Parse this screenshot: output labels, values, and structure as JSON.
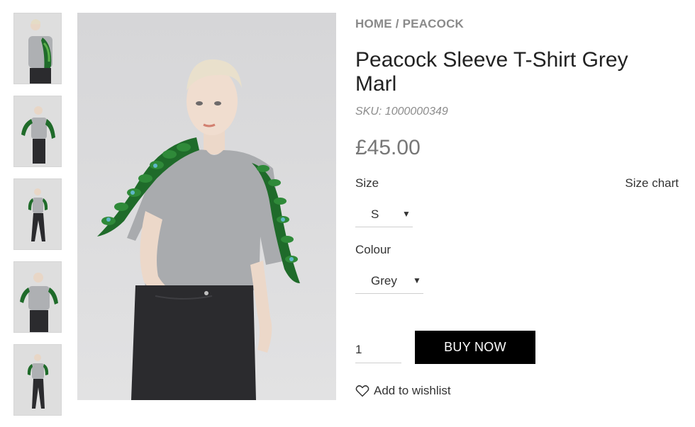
{
  "breadcrumb": {
    "home": "HOME",
    "separator": "/",
    "current": "PEACOCK"
  },
  "product": {
    "title": "Peacock Sleeve T-Shirt Grey Marl",
    "sku": "SKU: 1000000349",
    "price": "£45.00"
  },
  "options": {
    "size_label": "Size",
    "size_chart_link": "Size chart",
    "size_value": "S",
    "colour_label": "Colour",
    "colour_value": "Grey",
    "caret_glyph": "▼"
  },
  "purchase": {
    "quantity": "1",
    "buy_label": "BUY NOW",
    "wishlist_label": "Add to wishlist"
  },
  "gallery": {
    "thumbnail_count": 5,
    "icons": [
      "heart-icon",
      "caret-down-icon"
    ]
  },
  "colors": {
    "buy_button_bg": "#000000",
    "buy_button_text": "#ffffff",
    "muted_text": "#8a8a8a",
    "price_text": "#777777",
    "peacock_green": "#1f6b2a",
    "shirt_grey": "#a9abae",
    "jeans_dark": "#2b2b2e"
  }
}
